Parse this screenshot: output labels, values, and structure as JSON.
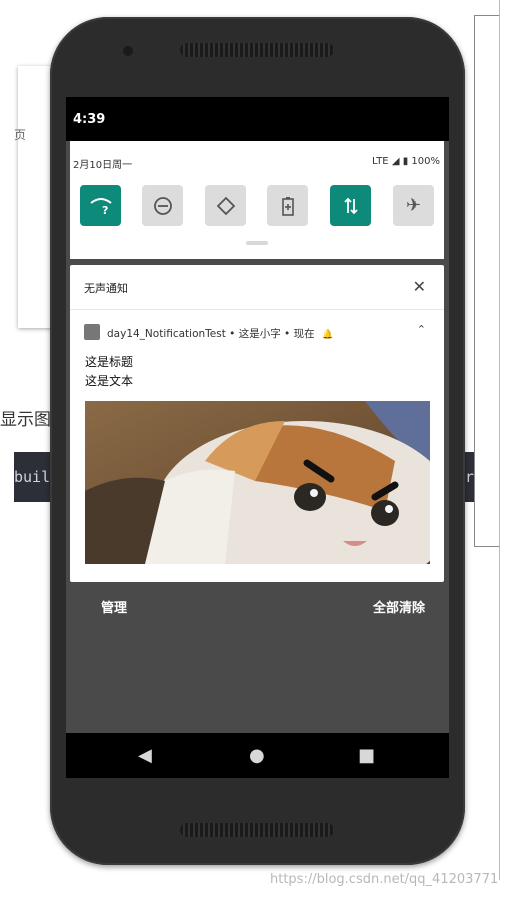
{
  "background": {
    "icon_tile_label": "页",
    "partial_text": "显示图",
    "code_snippet": "buil",
    "code_tail": "r"
  },
  "status_bar": {
    "time": "4:39"
  },
  "quick_settings": {
    "date": "2月10日周一",
    "network": "LTE",
    "battery": "100%",
    "tiles": [
      {
        "icon": "wifi-question-icon",
        "on": true
      },
      {
        "icon": "dnd-icon",
        "on": false
      },
      {
        "icon": "auto-rotate-icon",
        "on": false
      },
      {
        "icon": "battery-saver-icon",
        "on": false
      },
      {
        "icon": "mobile-data-icon",
        "on": true
      },
      {
        "icon": "airplane-mode-icon",
        "on": false
      }
    ]
  },
  "notification": {
    "section_label": "无声通知",
    "app_header": "day14_NotificationTest • 这是小字 • 现在",
    "title": "这是标题",
    "text": "这是文本"
  },
  "actions": {
    "manage": "管理",
    "clear_all": "全部清除"
  },
  "watermark": "https://blog.csdn.net/qq_41203771",
  "colors": {
    "accent": "#0e8a7a",
    "tile_off": "#dcdcdc",
    "shade": "#4a4a4a"
  }
}
